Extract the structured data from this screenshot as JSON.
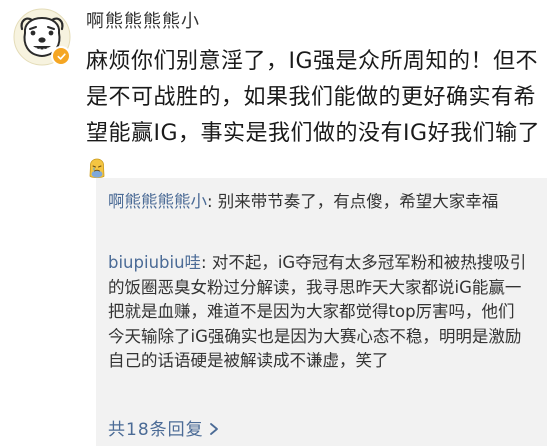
{
  "comment": {
    "username": "啊熊熊熊熊小",
    "avatar_icon": "bear-face-avatar",
    "badge_icon": "verified-badge-icon",
    "badge_color": "#f5a623",
    "text": "麻烦你们别意淫了，IG强是众所周知的！但不是不可战胜的，如果我们能做的更好确实有希望能赢IG，事实是我们做的没有IG好我们输了",
    "emoji_icon": "sad-tearful-emoji-icon"
  },
  "replies": [
    {
      "author": "啊熊熊熊熊小",
      "text": ": 别来带节奏了，有点傻，希望大家幸福"
    },
    {
      "author": "biupiubiu哇",
      "text": ": 对不起，iG夺冠有太多冠军粉和被热搜吸引的饭圈恶臭女粉过分解读，我寻思昨天大家都说iG能赢一把就是血赚，难道不是因为大家都觉得top厉害吗，他们今天输除了iG强确实也是因为大赛心态不稳，明明是激励自己的话语硬是被解读成不谦虚，笑了"
    }
  ],
  "view_replies": {
    "label": "共18条回复",
    "icon": "chevron-right-icon"
  },
  "colors": {
    "link": "#4b6b96",
    "reply_bg": "#f2f2f2",
    "text": "#1a1a1a"
  }
}
